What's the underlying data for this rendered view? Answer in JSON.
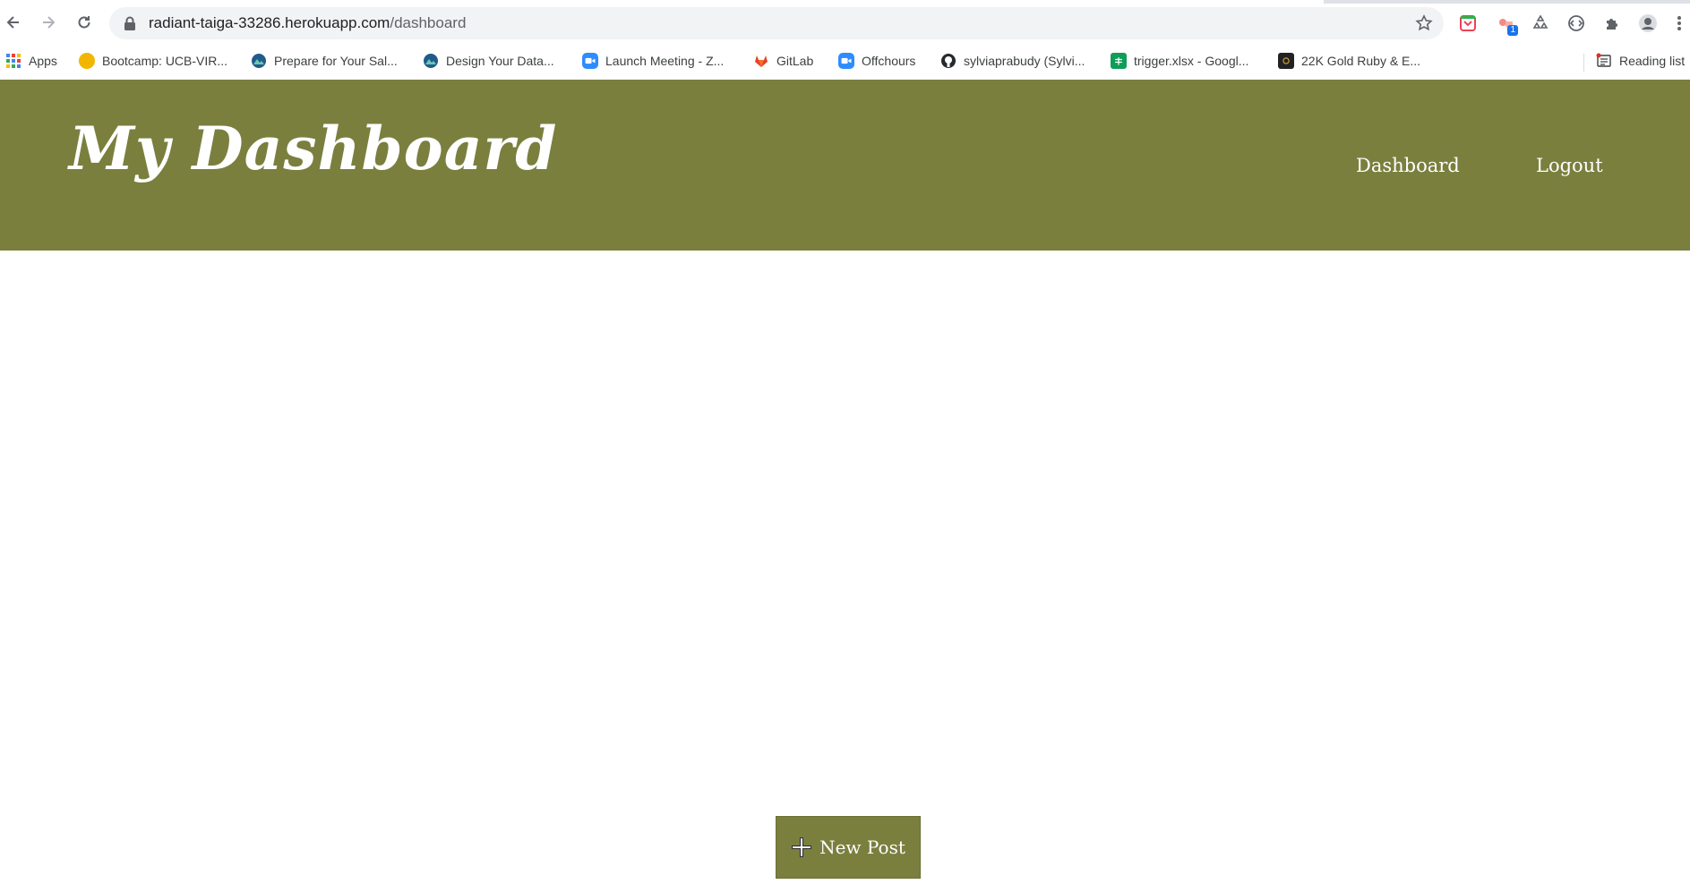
{
  "browser": {
    "url_host": "radiant-taiga-33286.herokuapp.com",
    "url_path": "/dashboard",
    "extension_badge": "1",
    "bookmarks": [
      {
        "label": "Apps",
        "color": "#4285f4"
      },
      {
        "label": "Bootcamp: UCB-VIR...",
        "color": "#f2b600"
      },
      {
        "label": "Prepare for Your Sal...",
        "color": "#1f5c8a"
      },
      {
        "label": "Design Your Data...",
        "color": "#1f5c8a"
      },
      {
        "label": "Launch Meeting - Z...",
        "color": "#2d8cff"
      },
      {
        "label": "GitLab",
        "color": "#e24329"
      },
      {
        "label": "Offchours",
        "color": "#2d8cff"
      },
      {
        "label": "sylviaprabudy (Sylvi...",
        "color": "#24292e"
      },
      {
        "label": "trigger.xlsx - Googl...",
        "color": "#0f9d58"
      },
      {
        "label": "22K Gold Ruby & E...",
        "color": "#222222"
      }
    ],
    "reading_list": "Reading list"
  },
  "header": {
    "title": "My Dashboard",
    "nav": {
      "dashboard": "Dashboard",
      "logout": "Logout"
    },
    "background_color": "#7a7f3e"
  },
  "main": {
    "new_post_label": "New Post"
  }
}
